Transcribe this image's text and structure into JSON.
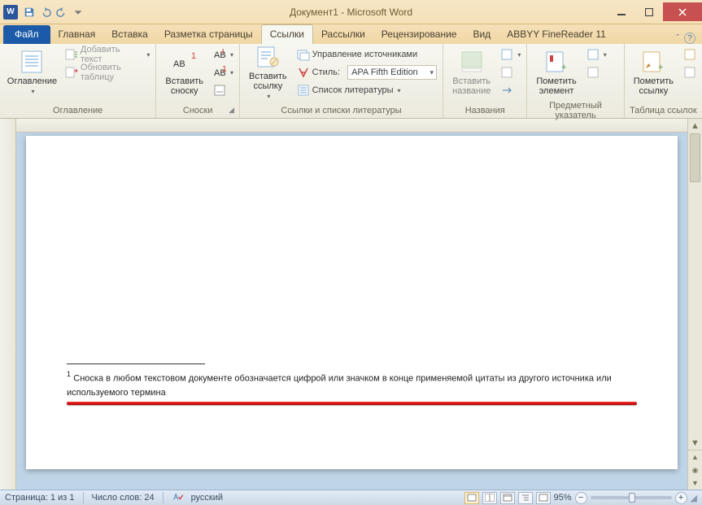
{
  "title": "Документ1 - Microsoft Word",
  "app_badge": "W",
  "tabs": {
    "file": "Файл",
    "items": [
      "Главная",
      "Вставка",
      "Разметка страницы",
      "Ссылки",
      "Рассылки",
      "Рецензирование",
      "Вид",
      "ABBYY FineReader 11"
    ],
    "active_index": 3
  },
  "ribbon": {
    "toc": {
      "big": "Оглавление",
      "add_text": "Добавить текст",
      "update_table": "Обновить таблицу",
      "group": "Оглавление"
    },
    "footnotes": {
      "insert_footnote": "Вставить\nсноску",
      "group": "Сноски"
    },
    "citations": {
      "insert_citation": "Вставить\nссылку",
      "manage_sources": "Управление источниками",
      "style_label": "Стиль:",
      "style_value": "APA Fifth Edition",
      "bibliography": "Список литературы",
      "group": "Ссылки и списки литературы"
    },
    "captions": {
      "insert_caption": "Вставить\nназвание",
      "group": "Названия"
    },
    "index": {
      "mark_entry": "Пометить\nэлемент",
      "group": "Предметный указатель"
    },
    "toa": {
      "mark_citation": "Пометить\nссылку",
      "group": "Таблица ссылок"
    }
  },
  "document": {
    "footnote_number": "1",
    "footnote_text": "Сноска в любом текстовом документе обозначается цифрой или значком в конце применяемой цитаты из другого источника или используемого термина"
  },
  "statusbar": {
    "page": "Страница: 1 из 1",
    "words": "Число слов: 24",
    "language": "русский",
    "zoom": "95%"
  }
}
